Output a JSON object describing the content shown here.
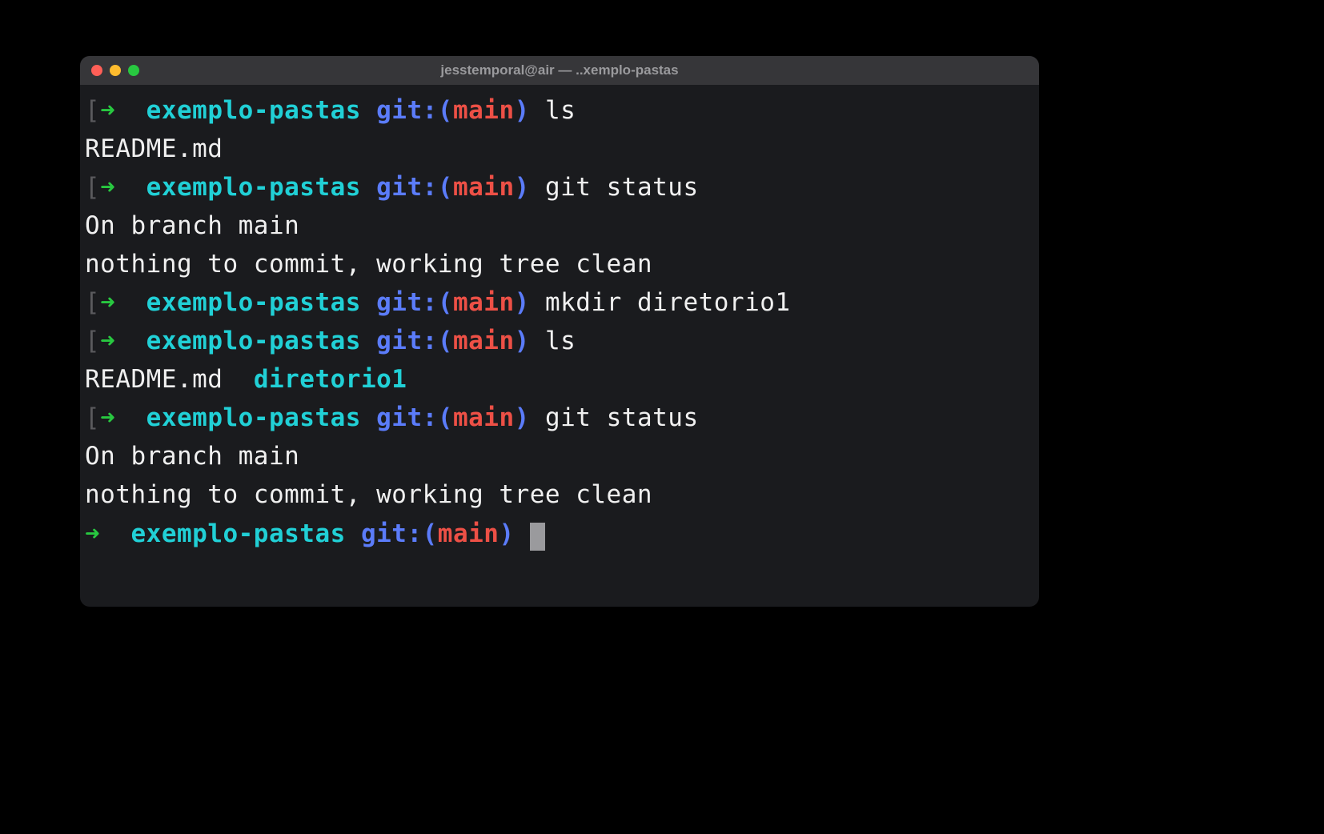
{
  "window": {
    "title": "jesstemporal@air — ..xemplo-pastas"
  },
  "prompt": {
    "bracket_left": "[",
    "arrow": "➜",
    "dir": "exemplo-pastas",
    "git_prefix": "git:(",
    "branch": "main",
    "git_suffix": ")",
    "bracket_right": "]"
  },
  "commands": {
    "ls": "ls",
    "git_status": "git status",
    "mkdir": "mkdir diretorio1"
  },
  "outputs": {
    "readme": "README.md",
    "ls2_line": "README.md  ",
    "ls2_dir": "diretorio1",
    "branch_line": "On branch main",
    "clean_line": "nothing to commit, working tree clean"
  }
}
